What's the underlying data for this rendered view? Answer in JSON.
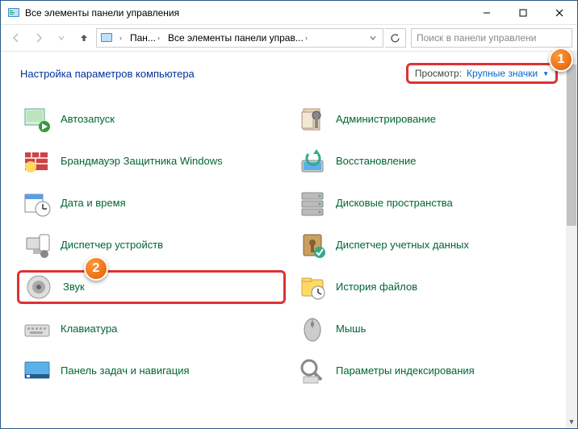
{
  "window": {
    "title": "Все элементы панели управления"
  },
  "breadcrumb": {
    "part1": "Пан...",
    "part2": "Все элементы панели управ..."
  },
  "search": {
    "placeholder": "Поиск в панели управлени"
  },
  "head": {
    "heading": "Настройка параметров компьютера"
  },
  "view": {
    "label": "Просмотр:",
    "value": "Крупные значки"
  },
  "callouts": {
    "one": "1",
    "two": "2"
  },
  "items": {
    "autoplay": "Автозапуск",
    "admin": "Администрирование",
    "firewall": "Брандмауэр Защитника Windows",
    "recovery": "Восстановление",
    "datetime": "Дата и время",
    "storage": "Дисковые пространства",
    "devices": "Диспетчер устройств",
    "credmgr": "Диспетчер учетных данных",
    "sound": "Звук",
    "filehist": "История файлов",
    "keyboard": "Клавиатура",
    "mouse": "Мышь",
    "taskbar": "Панель задач и навигация",
    "indexing": "Параметры индексирования"
  }
}
